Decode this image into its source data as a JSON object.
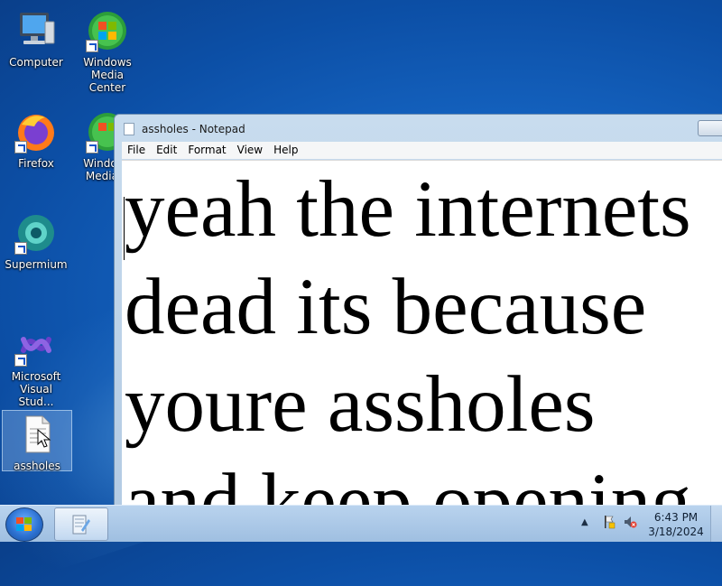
{
  "desktop": {
    "icons": [
      {
        "label": "Computer",
        "icon": "computer-icon"
      },
      {
        "label": "Windows Media Center",
        "icon": "windows-media-center-icon"
      },
      {
        "label": "Firefox",
        "icon": "firefox-icon"
      },
      {
        "label": "Windows Media C",
        "icon": "windows-media-center-icon"
      },
      {
        "label": "Supermium",
        "icon": "supermium-icon"
      },
      {
        "label": "Microsoft Visual Stud...",
        "icon": "visual-studio-icon"
      },
      {
        "label": "assholes",
        "icon": "text-file-icon"
      }
    ]
  },
  "notepad": {
    "title": "assholes - Notepad",
    "menu": [
      "File",
      "Edit",
      "Format",
      "View",
      "Help"
    ],
    "content": "yeah the internets\ndead its because\nyoure assholes\nand keep opening"
  },
  "taskbar": {
    "time": "6:43 PM",
    "date": "3/18/2024",
    "colors": {
      "start": "#2d72d2",
      "taskbar": "#b9d3ee"
    }
  }
}
